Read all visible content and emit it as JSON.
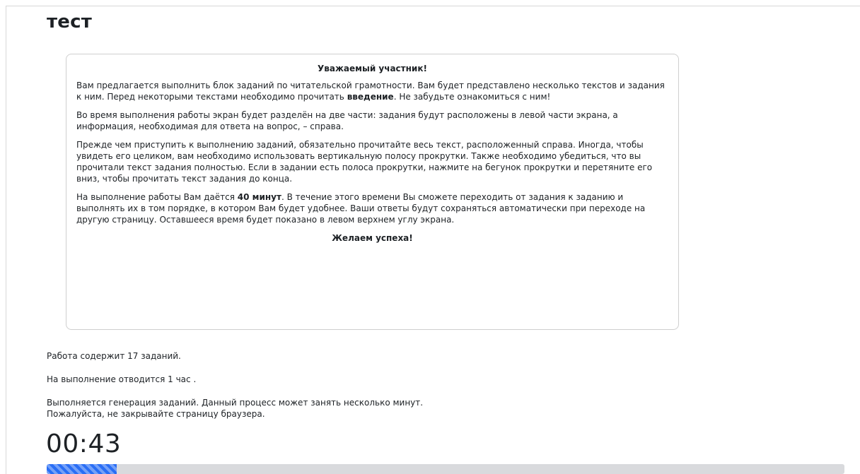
{
  "page": {
    "title": "тест"
  },
  "intro": {
    "greeting": "Уважаемый участник!",
    "p1_a": "Вам предлагается выполнить блок заданий по читательской грамотности. Вам будет представлено несколько текстов и задания к ним. Перед некоторыми текстами необходимо прочитать ",
    "p1_bold": "введение",
    "p1_b": ". Не забудьте ознакомиться с ним!",
    "p2": "Во время выполнения работы экран будет разделён на две части: задания будут расположены в левой части экрана, а информация, необходимая для ответа на вопрос, – справа.",
    "p3": "Прежде чем приступить к выполнению заданий, обязательно прочитайте весь текст, расположенный справа. Иногда, чтобы увидеть его целиком, вам необходимо использовать вертикальную полосу прокрутки. Также необходимо убедиться, что вы прочитали текст задания полностью. Если в задании есть полоса прокрутки, нажмите на бегунок прокрутки и перетяните его вниз, чтобы прочитать текст задания до конца.",
    "p4_a": "На выполнение работы Вам даётся ",
    "p4_bold": "40 минут",
    "p4_b": ". В течение этого времени Вы сможете переходить от задания к заданию и выполнять их в том порядке, в котором Вам будет удобнее. Ваши ответы будут сохраняться автоматически при переходе на другую страницу. Оставшееся время будет показано в левом верхнем углу экрана.",
    "closing": "Желаем успеха!"
  },
  "info": {
    "tasks_prefix": "Работа содержит ",
    "tasks_count": "17 заданий.",
    "time_prefix": "На выполнение отводится ",
    "time_value": "1 час",
    "time_suffix": " .",
    "generating_line1": "Выполняется генерация заданий. Данный процесс может занять несколько минут.",
    "generating_line2": "Пожалуйста, не закрывайте страницу браузера."
  },
  "timer": {
    "value": "00:43"
  },
  "progress": {
    "fraction": 0.088,
    "fill_color": "#2a6ef5",
    "track_color": "#d9dadd"
  }
}
